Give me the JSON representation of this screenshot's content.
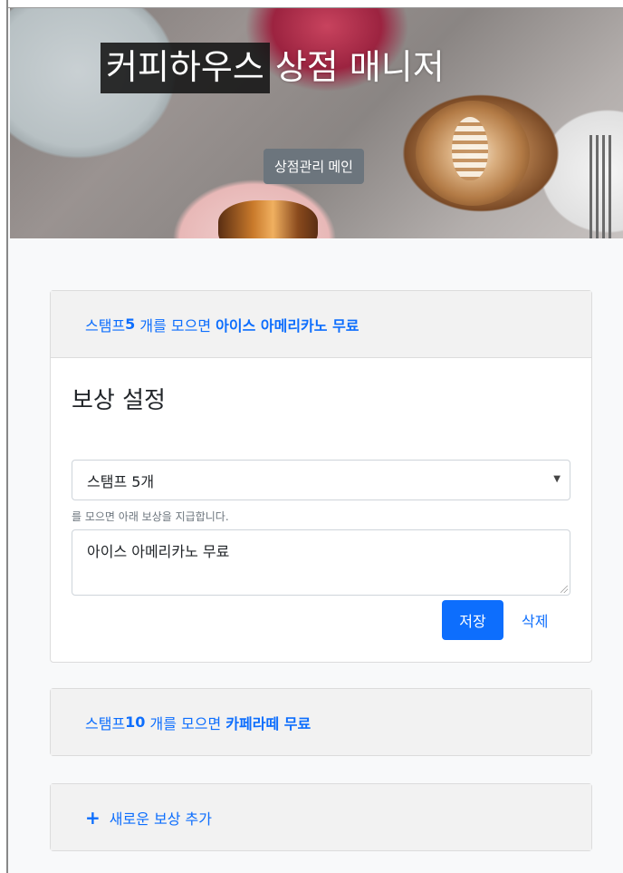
{
  "hero": {
    "title_part1": "커피하우스",
    "title_part2": "상점 매니저",
    "main_button": "상점관리 메인"
  },
  "rewards": [
    {
      "prefix": "스탬프 ",
      "count": "5",
      "middle": " 개를 모으면 ",
      "reward": "아이스 아메리카노 무료",
      "expanded": true
    },
    {
      "prefix": "스탬프 ",
      "count": "10",
      "middle": " 개를 모으면 ",
      "reward": "카페라떼 무료",
      "expanded": false
    }
  ],
  "editor": {
    "section_title": "보상 설정",
    "select_value": "스탬프 5개",
    "help_text": "를 모으면 아래 보상을 지급합니다.",
    "reward_text": "아이스 아메리카노 무료",
    "save_label": "저장",
    "delete_label": "삭제"
  },
  "add_reward": {
    "icon": "plus-icon",
    "label": "새로운 보상 추가"
  },
  "colors": {
    "accent": "#0d6efd",
    "secondary": "#6c757d"
  }
}
